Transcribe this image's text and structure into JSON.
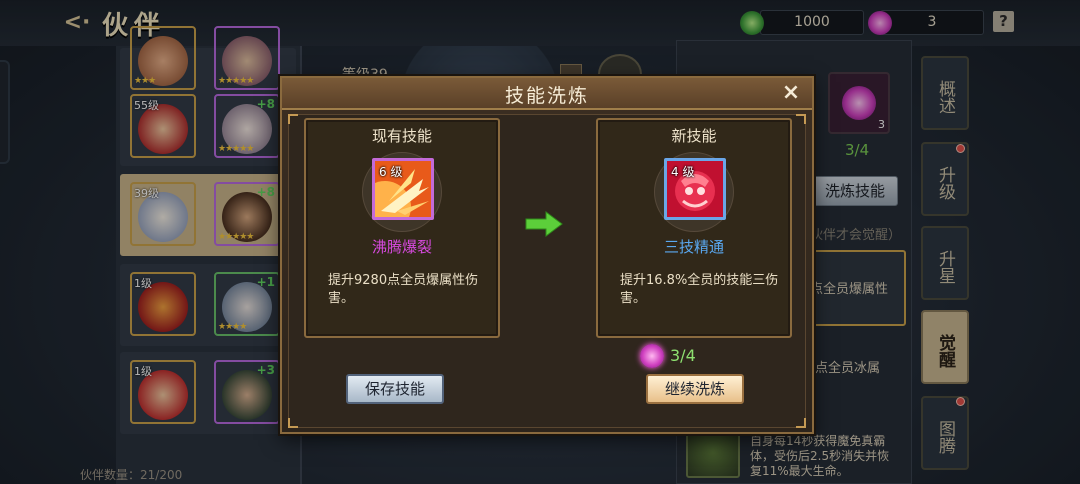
{
  "header": {
    "title": "伙伴",
    "back_label": "<·"
  },
  "resources": {
    "coin": {
      "value": "1000",
      "icon": "jade-coin-icon"
    },
    "gem": {
      "value": "3",
      "icon": "purple-orb-icon"
    },
    "help_label": "?"
  },
  "partners": {
    "list": [
      {
        "level": "55级",
        "plus": "",
        "rarity": "gold"
      },
      {
        "level": "",
        "plus": "+8",
        "rarity": "gold"
      },
      {
        "level": "39级",
        "plus": "",
        "rarity": "gold",
        "selected": true
      },
      {
        "level": "",
        "plus": "+8",
        "rarity": "gold"
      },
      {
        "level": "1级",
        "plus": "",
        "rarity": "gold"
      },
      {
        "level": "",
        "plus": "+1",
        "rarity": "green"
      },
      {
        "level": "1级",
        "plus": "",
        "rarity": "gold"
      },
      {
        "level": "",
        "plus": "+3",
        "rarity": "purple"
      }
    ],
    "count_label": "伙伴数量：21/200"
  },
  "background": {
    "level_text": "等级39",
    "slot_count": "3",
    "progress": "3/4",
    "refine_button": "洗炼技能",
    "note": "伙伴才会觉醒）",
    "desc_a": "点全员爆属性",
    "desc_b": "点全员冰属",
    "desc_c": "自身每14秒获得魔免真霸体，受伤后2.5秒消失并恢复11%最大生命。"
  },
  "side_tabs": [
    {
      "label": "概述",
      "active": false,
      "dot": false
    },
    {
      "label": "升级",
      "active": false,
      "dot": true
    },
    {
      "label": "升星",
      "active": false,
      "dot": false
    },
    {
      "label": "觉醒",
      "active": true,
      "dot": false
    },
    {
      "label": "图腾",
      "active": false,
      "dot": true
    }
  ],
  "modal": {
    "title": "技能洗炼",
    "close_label": "×",
    "current": {
      "heading": "现有技能",
      "level": "6 级",
      "name": "沸腾爆裂",
      "name_color": "#d84ae0",
      "desc": "提升9280点全员爆属性伤害。"
    },
    "new": {
      "heading": "新技能",
      "level": "4 级",
      "name": "三技精通",
      "name_color": "#5aa8f0",
      "desc": "提升16.8%全员的技能三伤害。"
    },
    "cost": {
      "icon": "purple-orb-icon",
      "value": "3/4"
    },
    "save_button": "保存技能",
    "continue_button": "继续洗炼"
  },
  "colors": {
    "gold_frame": "#c9a14a",
    "modal_border": "#8a6a3e",
    "arrow": "#5ccf3a"
  }
}
